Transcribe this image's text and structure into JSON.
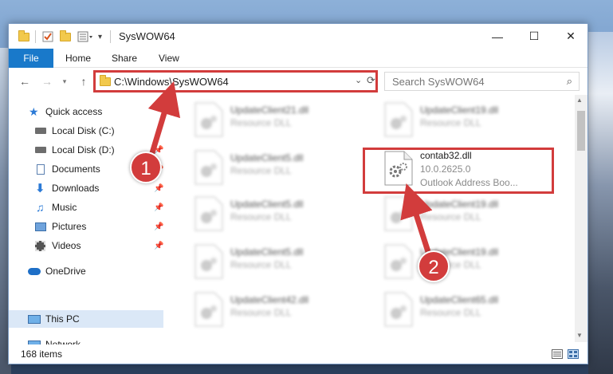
{
  "window": {
    "title": "SysWOW64",
    "minimize_glyph": "—",
    "maximize_glyph": "☐",
    "close_glyph": "✕"
  },
  "ribbon": {
    "tabs": [
      "File",
      "Home",
      "Share",
      "View"
    ]
  },
  "address": {
    "path": "C:\\Windows\\SysWOW64",
    "search_placeholder": "Search SysWOW64"
  },
  "sidebar": {
    "items": [
      {
        "label": "Quick access",
        "icon": "star-icon"
      },
      {
        "label": "Local Disk (C:)",
        "icon": "drive-icon"
      },
      {
        "label": "Local Disk (D:)",
        "icon": "drive-icon"
      },
      {
        "label": "Documents",
        "icon": "documents-icon"
      },
      {
        "label": "Downloads",
        "icon": "downloads-icon"
      },
      {
        "label": "Music",
        "icon": "music-icon"
      },
      {
        "label": "Pictures",
        "icon": "pictures-icon"
      },
      {
        "label": "Videos",
        "icon": "videos-icon"
      },
      {
        "label": "OneDrive",
        "icon": "cloud-icon"
      },
      {
        "label": "This PC",
        "icon": "computer-icon"
      },
      {
        "label": "Network",
        "icon": "network-icon"
      }
    ]
  },
  "files": {
    "col1": [
      {
        "name": "UpdateClient21.dll",
        "type": "Resource DLL"
      },
      {
        "name": "UpdateClient5.dll",
        "type": "Resource DLL"
      },
      {
        "name": "UpdateClient5.dll",
        "type": "Resource DLL"
      },
      {
        "name": "UpdateClient5.dll",
        "type": "Resource DLL"
      },
      {
        "name": "UpdateClient42.dll",
        "type": "Resource DLL"
      }
    ],
    "col2": [
      {
        "name": "UpdateClient19.dll",
        "type": "Resource DLL"
      },
      {
        "name": "UpdateClient19.dll",
        "type": "Resource DLL"
      },
      {
        "name": "UpdateClient19.dll",
        "type": "Resource DLL"
      },
      {
        "name": "UpdateClient65.dll",
        "type": "Resource DLL"
      }
    ],
    "highlighted": {
      "name": "contab32.dll",
      "version": "10.0.2625.0",
      "description": "Outlook Address Boo..."
    }
  },
  "status": {
    "item_count": "168 items"
  },
  "markers": {
    "one": "1",
    "two": "2"
  },
  "colors": {
    "accent": "#1979ca",
    "highlight_red": "#d23c3c",
    "selected_bg": "#dbe8f7"
  }
}
